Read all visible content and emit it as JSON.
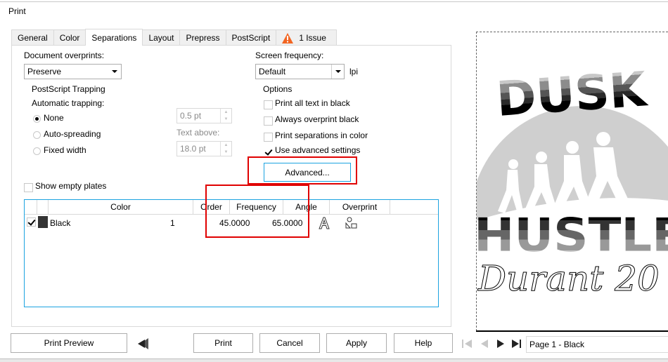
{
  "window": {
    "title": "Print"
  },
  "tabs": [
    {
      "label": "General",
      "active": false
    },
    {
      "label": "Color",
      "active": false
    },
    {
      "label": "Separations",
      "active": true
    },
    {
      "label": "Layout",
      "active": false
    },
    {
      "label": "Prepress",
      "active": false
    },
    {
      "label": "PostScript",
      "active": false
    },
    {
      "label": "1 Issue",
      "active": false,
      "icon": "warning-icon"
    }
  ],
  "left": {
    "document_overprints_label": "Document overprints:",
    "document_overprints_value": "Preserve",
    "postscript_trapping_label": "PostScript Trapping",
    "automatic_trapping_label": "Automatic trapping:",
    "radios": [
      {
        "label": "None",
        "selected": true
      },
      {
        "label": "Auto-spreading",
        "selected": false
      },
      {
        "label": "Fixed width",
        "selected": false
      }
    ],
    "width_value": "0.5 pt",
    "text_above_label": "Text above:",
    "text_above_value": "18.0 pt",
    "show_empty_plates_label": "Show empty plates",
    "show_empty_plates_checked": false
  },
  "right": {
    "screen_frequency_label": "Screen frequency:",
    "screen_frequency_value": "Default",
    "lpi_label": "lpi",
    "options_label": "Options",
    "options": [
      {
        "label": "Print all text in black",
        "checked": false
      },
      {
        "label": "Always overprint black",
        "checked": false
      },
      {
        "label": "Print separations in color",
        "checked": false
      },
      {
        "label": "Use advanced settings",
        "checked": true
      }
    ],
    "advanced_button": "Advanced..."
  },
  "table": {
    "headers": [
      "",
      "",
      "Color",
      "Order",
      "Frequency",
      "Angle",
      "Overprint"
    ],
    "rows": [
      {
        "checked": true,
        "swatch": "#333333",
        "color": "Black",
        "order": "1",
        "frequency": "45.0000",
        "angle": "65.0000"
      }
    ],
    "overprint_icons": [
      "overprint-text-icon",
      "overprint-graphics-icon"
    ]
  },
  "footer": {
    "print_preview": "Print Preview",
    "collapse_icon": "double-chevron-left-icon",
    "print": "Print",
    "cancel": "Cancel",
    "apply": "Apply",
    "help": "Help"
  },
  "preview": {
    "page_label": "Page 1 - Black",
    "artwork_top_text": "DUSK",
    "artwork_middle_text": "HUSTLE",
    "artwork_script_text": "Durant 20"
  },
  "colors": {
    "focus_accent": "#1ba3e0",
    "highlight_box": "#e00000",
    "warning": "#f26522"
  }
}
